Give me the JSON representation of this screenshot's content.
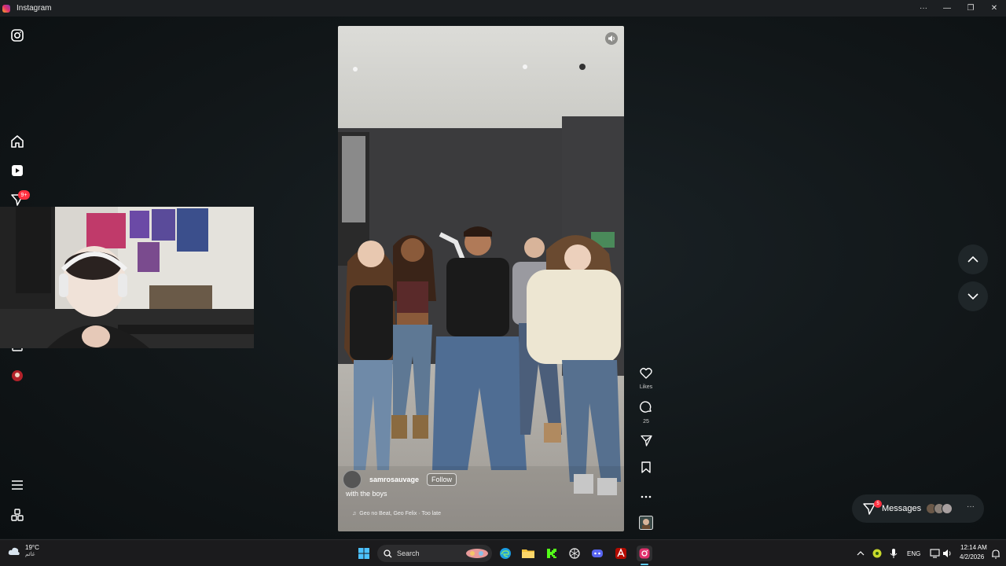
{
  "window": {
    "title": "Instagram",
    "controls": [
      "···",
      "—",
      "❐",
      "✕"
    ]
  },
  "sidebar": {
    "notification_badge": "9+"
  },
  "reel": {
    "creator": "samrosauvage",
    "follow_label": "Follow",
    "caption": "with the boys",
    "audio": "Geo no Beat, Geo Felix · Too late"
  },
  "actions": {
    "likes_label": "Likes",
    "comments_count": "25"
  },
  "messages": {
    "label": "Messages",
    "badge": "5"
  },
  "taskbar": {
    "temperature": "19°C",
    "weather_text": "غائم",
    "search_label": "Search",
    "language": "ENG",
    "time": "12:14 AM",
    "date": "4/2/2026"
  },
  "colors": {
    "accent": "#60cdff",
    "badge": "#ff3040",
    "background": "#0f1416"
  }
}
